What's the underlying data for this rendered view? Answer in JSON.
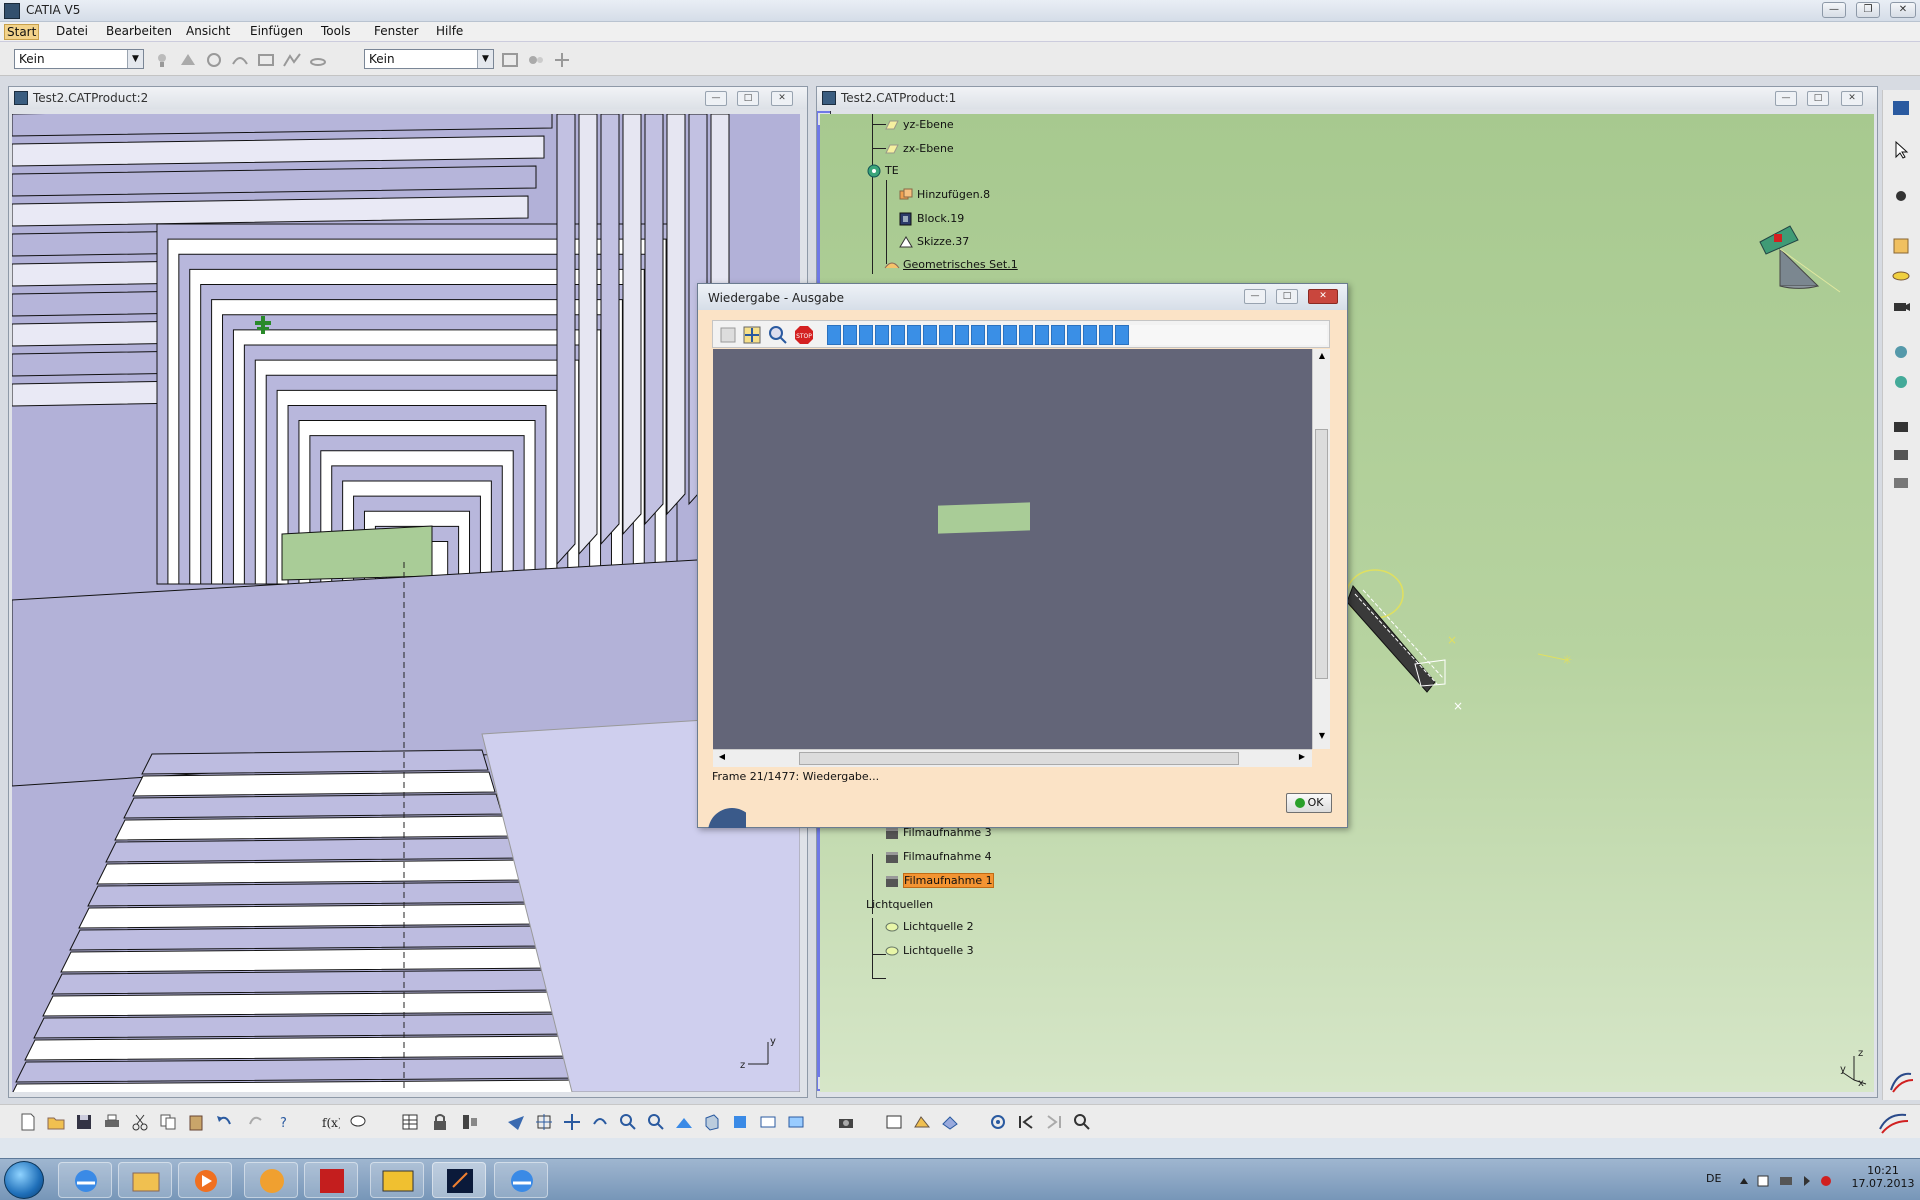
{
  "app": {
    "title": "CATIA V5"
  },
  "menu": [
    "Start",
    "Datei",
    "Bearbeiten",
    "Ansicht",
    "Einfügen",
    "Tools",
    "Fenster",
    "Hilfe"
  ],
  "toolbar": {
    "select_left": "Kein",
    "select_right": "Kein"
  },
  "windows": {
    "left": {
      "title": "Test2.CATProduct:2"
    },
    "right": {
      "title": "Test2.CATProduct:1"
    }
  },
  "tree": {
    "top": [
      "yz-Ebene",
      "zx-Ebene",
      "TE",
      "Hinzufügen.8",
      "Block.19",
      "Skizze.37",
      "Geometrisches Set.1"
    ],
    "bottom": [
      "Filmaufnahme 3",
      "Filmaufnahme 4",
      "Filmaufnahme 1",
      "Lichtquellen",
      "Lichtquelle 2",
      "Lichtquelle 3"
    ]
  },
  "dialog": {
    "title": "Wiedergabe - Ausgabe",
    "status": "Frame 21/1477: Wiedergabe...",
    "ok_label": "OK",
    "progress": {
      "frame": 21,
      "total": 1477
    }
  },
  "taskbar": {
    "language": "DE",
    "time": "10:21",
    "date": "17.07.2013"
  },
  "colors": {
    "viewport_left": "#b2b1d8",
    "viewport_right": "#a7c98f",
    "dialog_bg": "#fbe3c6",
    "preview_bg": "#636578",
    "progress": "#3a8fe6"
  }
}
